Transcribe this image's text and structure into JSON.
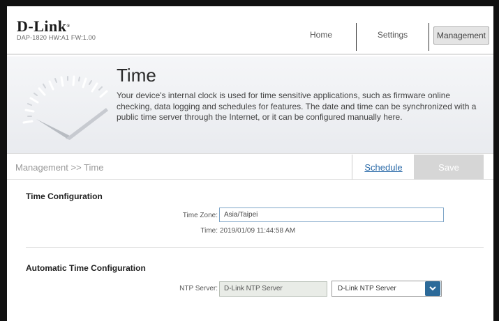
{
  "header": {
    "logo": "D-Link",
    "model_info": "DAP-1820  HW:A1  FW:1.00",
    "nav": {
      "home": "Home",
      "settings": "Settings",
      "management": "Management"
    }
  },
  "banner": {
    "title": "Time",
    "description": "Your device's internal clock is used for time sensitive applications, such as firmware online checking, data logging and schedules for features. The date and time can be synchronized with a public time server through the Internet, or it can be configured manually here."
  },
  "toolbar": {
    "breadcrumb": "Management >> Time",
    "schedule_label": "Schedule",
    "save_label": "Save"
  },
  "time_config": {
    "section_title": "Time Configuration",
    "time_zone_label": "Time Zone:",
    "time_zone_value": "Asia/Taipei",
    "time_label": "Time:",
    "time_value": "2019/01/09 11:44:58 AM"
  },
  "auto_time": {
    "section_title": "Automatic Time Configuration",
    "ntp_label": "NTP Server:",
    "ntp_input_value": "D-Link NTP Server",
    "ntp_select_value": "D-Link NTP Server"
  },
  "colors": {
    "accent": "#2c6a99",
    "link": "#2a6aa8",
    "save_bg": "#d6d6d6"
  },
  "icons": {
    "select_toggle": "chevron-down-icon",
    "banner": "clock-icon"
  }
}
